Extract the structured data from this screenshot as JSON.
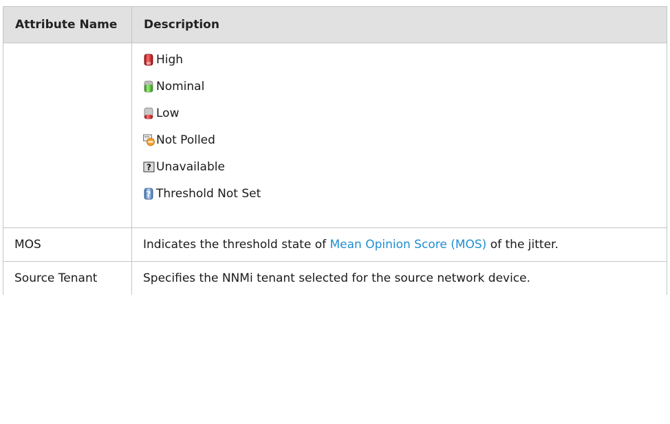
{
  "table": {
    "headers": {
      "col1": "Attribute Name",
      "col2": "Description"
    },
    "status_items": [
      {
        "icon": "threshold-high-icon",
        "label": "High"
      },
      {
        "icon": "threshold-nominal-icon",
        "label": "Nominal"
      },
      {
        "icon": "threshold-low-icon",
        "label": "Low"
      },
      {
        "icon": "not-polled-icon",
        "label": "Not Polled"
      },
      {
        "icon": "unavailable-icon",
        "label": "Unavailable"
      },
      {
        "icon": "threshold-not-set-icon",
        "label": "Threshold Not Set"
      }
    ],
    "rows": [
      {
        "name": "MOS",
        "desc_before": "Indicates the threshold state of ",
        "desc_link": "Mean Opinion Score (MOS)",
        "desc_after": " of the jitter."
      },
      {
        "name": "Source Tenant",
        "desc": "Specifies the NNMi tenant selected for the source network device."
      }
    ]
  },
  "colors": {
    "header_bg": "#e1e1e1",
    "border": "#c4c4c4",
    "link": "#1f8ed0"
  }
}
